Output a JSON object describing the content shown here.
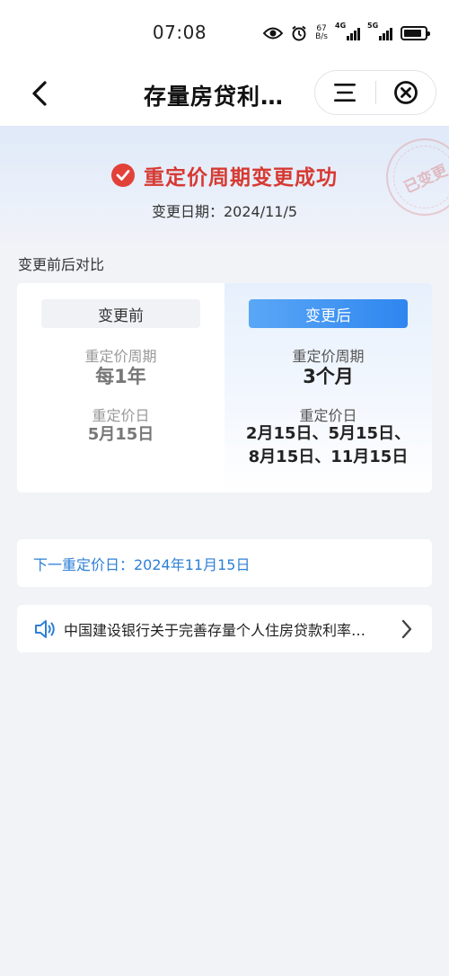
{
  "status_bar": {
    "time": "07:08",
    "net_speed_value": "67",
    "net_speed_unit": "B/s",
    "signal_1": "4G",
    "signal_2": "5G",
    "icons": [
      "eye-icon",
      "alarm-icon",
      "signal-4g-icon",
      "signal-5g-icon",
      "battery-icon"
    ],
    "battery_level": 0.85
  },
  "nav": {
    "title": "存量房贷利…",
    "icons": [
      "back-arrow-icon",
      "menu-icon",
      "close-circle-icon"
    ]
  },
  "hero": {
    "title": "重定价周期变更成功",
    "date_label": "变更日期：2024/11/5",
    "stamp": "已变更",
    "icon": "check-circle-icon",
    "accent_color": "#d63a33"
  },
  "comparison": {
    "section_label": "变更前后对比",
    "before": {
      "tag": "变更前",
      "period_label": "重定价周期",
      "period_value": "每1年",
      "date_label": "重定价日",
      "date_value": "5月15日"
    },
    "after": {
      "tag": "变更后",
      "period_label": "重定价周期",
      "period_value": "3个月",
      "date_label": "重定价日",
      "date_value_line1": "2月15日、5月15日、",
      "date_value_line2": "8月15日、11月15日"
    }
  },
  "next_date": {
    "text": "下一重定价日：2024年11月15日",
    "color": "#2d7fd6"
  },
  "notice": {
    "text": "中国建设银行关于完善存量个人住房贷款利率…",
    "icon": "speaker-icon",
    "arrow_icon": "chevron-right-icon"
  }
}
